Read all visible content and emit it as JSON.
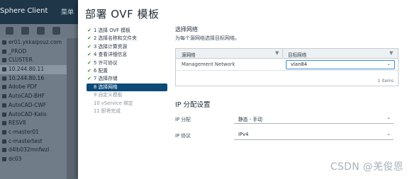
{
  "background": {
    "app_title": "Sphere Client",
    "menu_label": "菜单",
    "tree_items": [
      "er01.ykkaipsuz.com",
      "_PROD",
      "CLUSTER",
      "10.244.80.11",
      "10.244.80.16",
      "Adobe PDF",
      "AutoCAD-BHF",
      "AutoCAD-CWF",
      "AutoCAD-Kalis",
      "RESV8",
      "c-master01",
      "c-mastertest",
      "d4lb032mnfwzl",
      "dc03"
    ]
  },
  "dialog": {
    "title": "部署 OVF 模板",
    "steps": [
      {
        "label": "1 选择 OVF 模板",
        "state": "done"
      },
      {
        "label": "2 选择名称和文件夹",
        "state": "done"
      },
      {
        "label": "3 选择计算资源",
        "state": "done"
      },
      {
        "label": "4 查看详细信息",
        "state": "done"
      },
      {
        "label": "5 许可协议",
        "state": "done"
      },
      {
        "label": "6 配置",
        "state": "done"
      },
      {
        "label": "7 选择存储",
        "state": "done"
      },
      {
        "label": "8 选择网络",
        "state": "active"
      },
      {
        "label": "9 自定义模板",
        "state": "todo"
      },
      {
        "label": "10 vService 绑定",
        "state": "todo"
      },
      {
        "label": "11 即将完成",
        "state": "todo"
      }
    ],
    "check_glyph": "✔",
    "network": {
      "title": "选择网络",
      "subtitle": "为每个源网络选择目标网络。",
      "col_source": "源网络",
      "col_target": "目标网络",
      "rows": [
        {
          "source": "Management Network",
          "target": "vlan84"
        }
      ],
      "footer": "1 items"
    },
    "ip": {
      "title": "IP 分配设置",
      "allocation_label": "IP 分配",
      "allocation_value": "静态 - 手动",
      "protocol_label": "IP 协议",
      "protocol_value": "IPv4"
    }
  },
  "watermark": "CSDN @羌俊恩",
  "icons": {
    "filter": "filter-icon",
    "dropdown": "chevron-down-icon",
    "check": "check-icon"
  }
}
